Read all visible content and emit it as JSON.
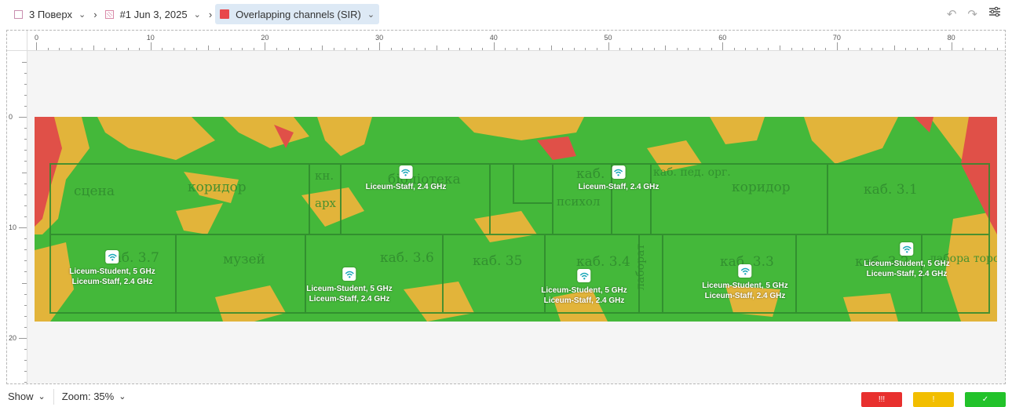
{
  "breadcrumbs": [
    {
      "label": "3 Поверх",
      "icon": "floor-icon"
    },
    {
      "label": "#1 Jun 3, 2025",
      "icon": "floorplan-icon"
    },
    {
      "label": "Overlapping channels (SIR)",
      "icon": "sir-legend-icon"
    }
  ],
  "toolbar": {
    "undo_icon": "undo-icon",
    "redo_icon": "redo-icon",
    "settings_icon": "filter-settings-icon"
  },
  "ruler": {
    "x_labels": [
      "0",
      "10",
      "20",
      "30",
      "40",
      "50",
      "60",
      "70",
      "80"
    ],
    "y_labels": [
      "0",
      "10",
      "20"
    ]
  },
  "rooms": [
    "сцена",
    "коридор",
    "кн.",
    "арх",
    "бібліотека",
    "каб.",
    "психол",
    "каб. пед. орг.",
    "коридор",
    "каб. 3.1",
    "каб. 3.7",
    "музей",
    "каб. 3.6",
    "каб. 35",
    "каб. 3.4",
    "лаборат",
    "каб. 3.3",
    "каб. 3.2",
    "лабора торська"
  ],
  "access_points": [
    {
      "lines": [
        "Liceum-Staff, 2.4 GHz"
      ]
    },
    {
      "lines": [
        "Liceum-Staff, 2.4 GHz"
      ]
    },
    {
      "lines": [
        "Liceum-Student, 5 GHz",
        "Liceum-Staff, 2.4 GHz"
      ]
    },
    {
      "lines": [
        "Liceum-Student, 5 GHz",
        "Liceum-Staff, 2.4 GHz"
      ]
    },
    {
      "lines": [
        "Liceum-Student, 5 GHz",
        "Liceum-Staff, 2.4 GHz"
      ]
    },
    {
      "lines": [
        "Liceum-Student, 5 GHz",
        "Liceum-Staff, 2.4 GHz"
      ]
    },
    {
      "lines": [
        "Liceum-Student, 5 GHz",
        "Liceum-Staff, 2.4 GHz"
      ]
    }
  ],
  "bottom": {
    "show_label": "Show",
    "zoom_label": "Zoom: 35%"
  },
  "legend": [
    {
      "label": "!!!",
      "color": "#e8302e"
    },
    {
      "label": "!",
      "color": "#f2be00"
    },
    {
      "label": "✓",
      "color": "#22c22a"
    }
  ],
  "colors": {
    "good": "#44b83a",
    "warn": "#e7b83a",
    "bad": "#e05048",
    "active_crumb": "#dde9f5"
  }
}
